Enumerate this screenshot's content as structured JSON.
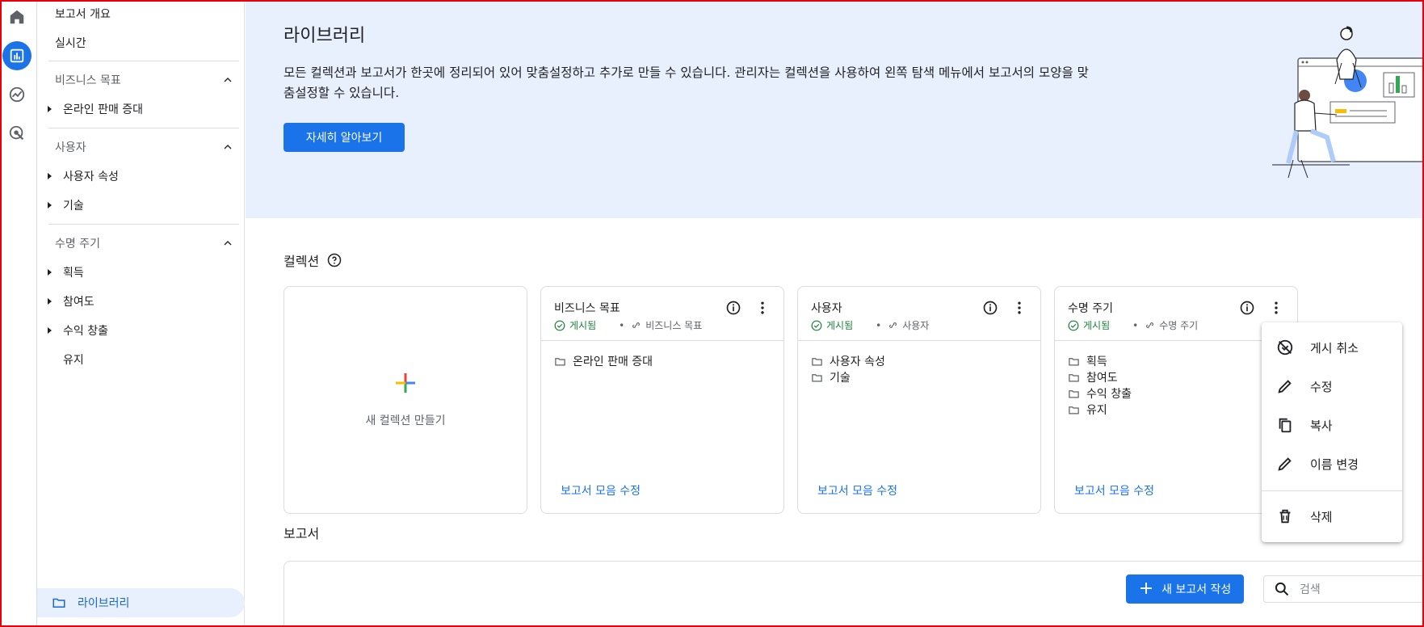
{
  "sidebar": {
    "overview": "보고서 개요",
    "realtime": "실시간",
    "sections": [
      {
        "title": "비즈니스 목표",
        "items": [
          {
            "label": "온라인 판매 증대",
            "expandable": true
          }
        ]
      },
      {
        "title": "사용자",
        "items": [
          {
            "label": "사용자 속성",
            "expandable": true
          },
          {
            "label": "기술",
            "expandable": true
          }
        ]
      },
      {
        "title": "수명 주기",
        "items": [
          {
            "label": "획득",
            "expandable": true
          },
          {
            "label": "참여도",
            "expandable": true
          },
          {
            "label": "수익 창출",
            "expandable": true
          },
          {
            "label": "유지",
            "expandable": false
          }
        ]
      }
    ],
    "library": "라이브러리"
  },
  "hero": {
    "title": "라이브러리",
    "description": "모든 컬렉션과 보고서가 한곳에 정리되어 있어 맞춤설정하고 추가로 만들 수 있습니다. 관리자는 컬렉션을 사용하여 왼쪽 탐색 메뉴에서 보고서의 모양을 맞춤설정할 수 있습니다.",
    "learn_more": "자세히 알아보기"
  },
  "collections": {
    "title": "컬렉션",
    "new_label": "새 컬렉션 만들기",
    "cards": [
      {
        "title": "비즈니스 목표",
        "status": "게시됨",
        "template": "비즈니스 목표",
        "items": [
          "온라인 판매 증대"
        ],
        "edit_link": "보고서 모음 수정"
      },
      {
        "title": "사용자",
        "status": "게시됨",
        "template": "사용자",
        "items": [
          "사용자 속성",
          "기술"
        ],
        "edit_link": "보고서 모음 수정"
      },
      {
        "title": "수명 주기",
        "status": "게시됨",
        "template": "수명 주기",
        "items": [
          "획득",
          "참여도",
          "수익 창출",
          "유지"
        ],
        "edit_link": "보고서 모음 수정"
      }
    ]
  },
  "reports": {
    "title": "보고서",
    "new_report": "새 보고서 작성",
    "search_placeholder": "검색"
  },
  "menu": {
    "items": [
      "게시 취소",
      "수정",
      "복사",
      "이름 변경",
      "삭제"
    ]
  },
  "colors": {
    "accent": "#1a73e8",
    "published": "#188038",
    "hero_bg": "#e8f0fe"
  }
}
